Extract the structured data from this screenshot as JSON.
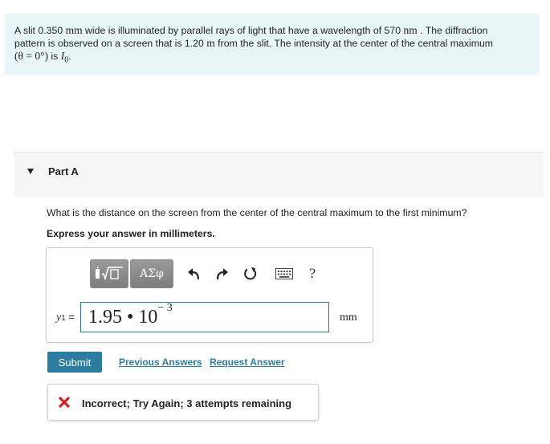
{
  "problem": {
    "line1_a": "A slit 0.350 ",
    "unit_mm": "mm",
    "line1_b": " wide is illuminated by parallel rays of light that have a wavelength of 570 ",
    "unit_nm": "nm",
    "line1_c": " . The diffraction",
    "line2_a": "pattern is observed on a screen that is 1.20 ",
    "unit_m": "m",
    "line2_b": " from the slit. The intensity at the center of the central maximum",
    "line3_math": "(θ = 0°)",
    "line3_mid": " is ",
    "line3_var": "I",
    "line3_sub": "0",
    "line3_end": "."
  },
  "part": {
    "title": "Part A"
  },
  "question": {
    "text": "What is the distance on the screen from the center of the central maximum to the first minimum?",
    "instruction": "Express your answer in millimeters."
  },
  "toolbar": {
    "symbols_label": "ΑΣφ",
    "help_label": "?",
    "icons": [
      "templates-icon",
      "undo-icon",
      "redo-icon",
      "reset-icon",
      "keyboard-icon",
      "help-icon"
    ]
  },
  "answer": {
    "variable": "y",
    "variable_sub": "1",
    "equals": "=",
    "mantissa": "1.95",
    "dot": "•",
    "base": "10",
    "exponent": "− 3",
    "unit": "mm"
  },
  "actions": {
    "submit": "Submit",
    "previous_answers": "Previous Answers",
    "request_answer": "Request Answer"
  },
  "feedback": {
    "text": "Incorrect; Try Again; 3 attempts remaining",
    "status_color": "#d0202a"
  },
  "colors": {
    "problem_bg": "#e8f6f8",
    "accent": "#2b7c9e"
  }
}
